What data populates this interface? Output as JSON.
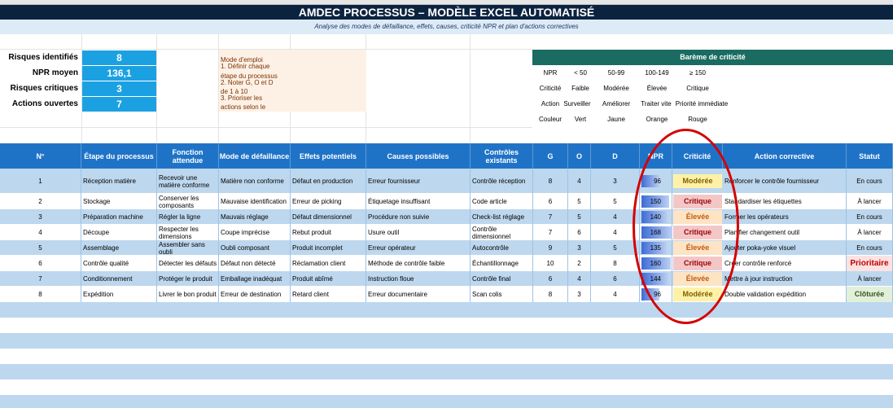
{
  "title": "AMDEC PROCESSUS – MODÈLE EXCEL AUTOMATISÉ",
  "subtitle": "Analyse des modes de défaillance, effets, causes, criticité NPR et plan d'actions correctives",
  "kpis": [
    {
      "label": "Risques identifiés",
      "value": "8"
    },
    {
      "label": "NPR moyen",
      "value": "136,1"
    },
    {
      "label": "Risques critiques",
      "value": "3"
    },
    {
      "label": "Actions ouvertes",
      "value": "7"
    }
  ],
  "mode_emploi": {
    "title": "Mode d'emploi",
    "lines": [
      "1. Définir chaque",
      "étape du processus",
      "2. Noter G, O et D",
      "de 1 à 10",
      "3. Prioriser les",
      "actions selon le"
    ]
  },
  "bareme": {
    "title": "Barème de criticité",
    "rows": [
      [
        "NPR",
        "< 50",
        "50-99",
        "100-149",
        "≥ 150"
      ],
      [
        "Criticité",
        "Faible",
        "Modérée",
        "Élevée",
        "Critique"
      ],
      [
        "Action",
        "Surveiller",
        "Améliorer",
        "Traiter vite",
        "Priorité immédiate"
      ],
      [
        "Couleur",
        "Vert",
        "Jaune",
        "Orange",
        "Rouge"
      ]
    ]
  },
  "table": {
    "headers": [
      "N°",
      "Étape du processus",
      "Fonction attendue",
      "Mode de défaillance",
      "Effets potentiels",
      "Causes possibles",
      "Contrôles existants",
      "G",
      "O",
      "D",
      "NPR",
      "Criticité",
      "Action corrective",
      "Statut"
    ],
    "rows": [
      {
        "n": "1",
        "etape": "Réception matière",
        "fonction": "Recevoir une matière conforme",
        "mode": "Matière non conforme",
        "effet": "Défaut en production",
        "cause": "Erreur fournisseur",
        "controle": "Contrôle réception",
        "g": "8",
        "o": "4",
        "d": "3",
        "npr": 96,
        "crit": "Modérée",
        "action": "Renforcer le contrôle fournisseur",
        "statut": "En cours"
      },
      {
        "n": "2",
        "etape": "Stockage",
        "fonction": "Conserver les composants",
        "mode": "Mauvaise identification",
        "effet": "Erreur de picking",
        "cause": "Étiquetage insuffisant",
        "controle": "Code article",
        "g": "6",
        "o": "5",
        "d": "5",
        "npr": 150,
        "crit": "Critique",
        "action": "Standardiser les étiquettes",
        "statut": "À lancer"
      },
      {
        "n": "3",
        "etape": "Préparation machine",
        "fonction": "Régler la ligne",
        "mode": "Mauvais réglage",
        "effet": "Défaut dimensionnel",
        "cause": "Procédure non suivie",
        "controle": "Check-list réglage",
        "g": "7",
        "o": "5",
        "d": "4",
        "npr": 140,
        "crit": "Élevée",
        "action": "Former les opérateurs",
        "statut": "En cours"
      },
      {
        "n": "4",
        "etape": "Découpe",
        "fonction": "Respecter les dimensions",
        "mode": "Coupe imprécise",
        "effet": "Rebut produit",
        "cause": "Usure outil",
        "controle": "Contrôle dimensionnel",
        "g": "7",
        "o": "6",
        "d": "4",
        "npr": 168,
        "crit": "Critique",
        "action": "Planifier changement outil",
        "statut": "À lancer"
      },
      {
        "n": "5",
        "etape": "Assemblage",
        "fonction": "Assembler sans oubli",
        "mode": "Oubli composant",
        "effet": "Produit incomplet",
        "cause": "Erreur opérateur",
        "controle": "Autocontrôle",
        "g": "9",
        "o": "3",
        "d": "5",
        "npr": 135,
        "crit": "Élevée",
        "action": "Ajouter poka-yoke visuel",
        "statut": "En cours"
      },
      {
        "n": "6",
        "etape": "Contrôle qualité",
        "fonction": "Détecter les défauts",
        "mode": "Défaut non détecté",
        "effet": "Réclamation client",
        "cause": "Méthode de contrôle faible",
        "controle": "Échantillonnage",
        "g": "10",
        "o": "2",
        "d": "8",
        "npr": 160,
        "crit": "Critique",
        "action": "Créer contrôle renforcé",
        "statut": "Prioritaire"
      },
      {
        "n": "7",
        "etape": "Conditionnement",
        "fonction": "Protéger le produit",
        "mode": "Emballage inadéquat",
        "effet": "Produit abîmé",
        "cause": "Instruction floue",
        "controle": "Contrôle final",
        "g": "6",
        "o": "4",
        "d": "6",
        "npr": 144,
        "crit": "Élevée",
        "action": "Mettre à jour instruction",
        "statut": "À lancer"
      },
      {
        "n": "8",
        "etape": "Expédition",
        "fonction": "Livrer le bon produit",
        "mode": "Erreur de destination",
        "effet": "Retard client",
        "cause": "Erreur documentaire",
        "controle": "Scan colis",
        "g": "8",
        "o": "3",
        "d": "4",
        "npr": 96,
        "crit": "Modérée",
        "action": "Double validation expédition",
        "statut": "Clôturée"
      }
    ]
  },
  "colors": {
    "title_bg": "#0c2340",
    "header_bg": "#1f73c7",
    "kpi_bg": "#1ba1e2",
    "bareme_bg": "#1a6b62",
    "annotation": "#d40000"
  }
}
